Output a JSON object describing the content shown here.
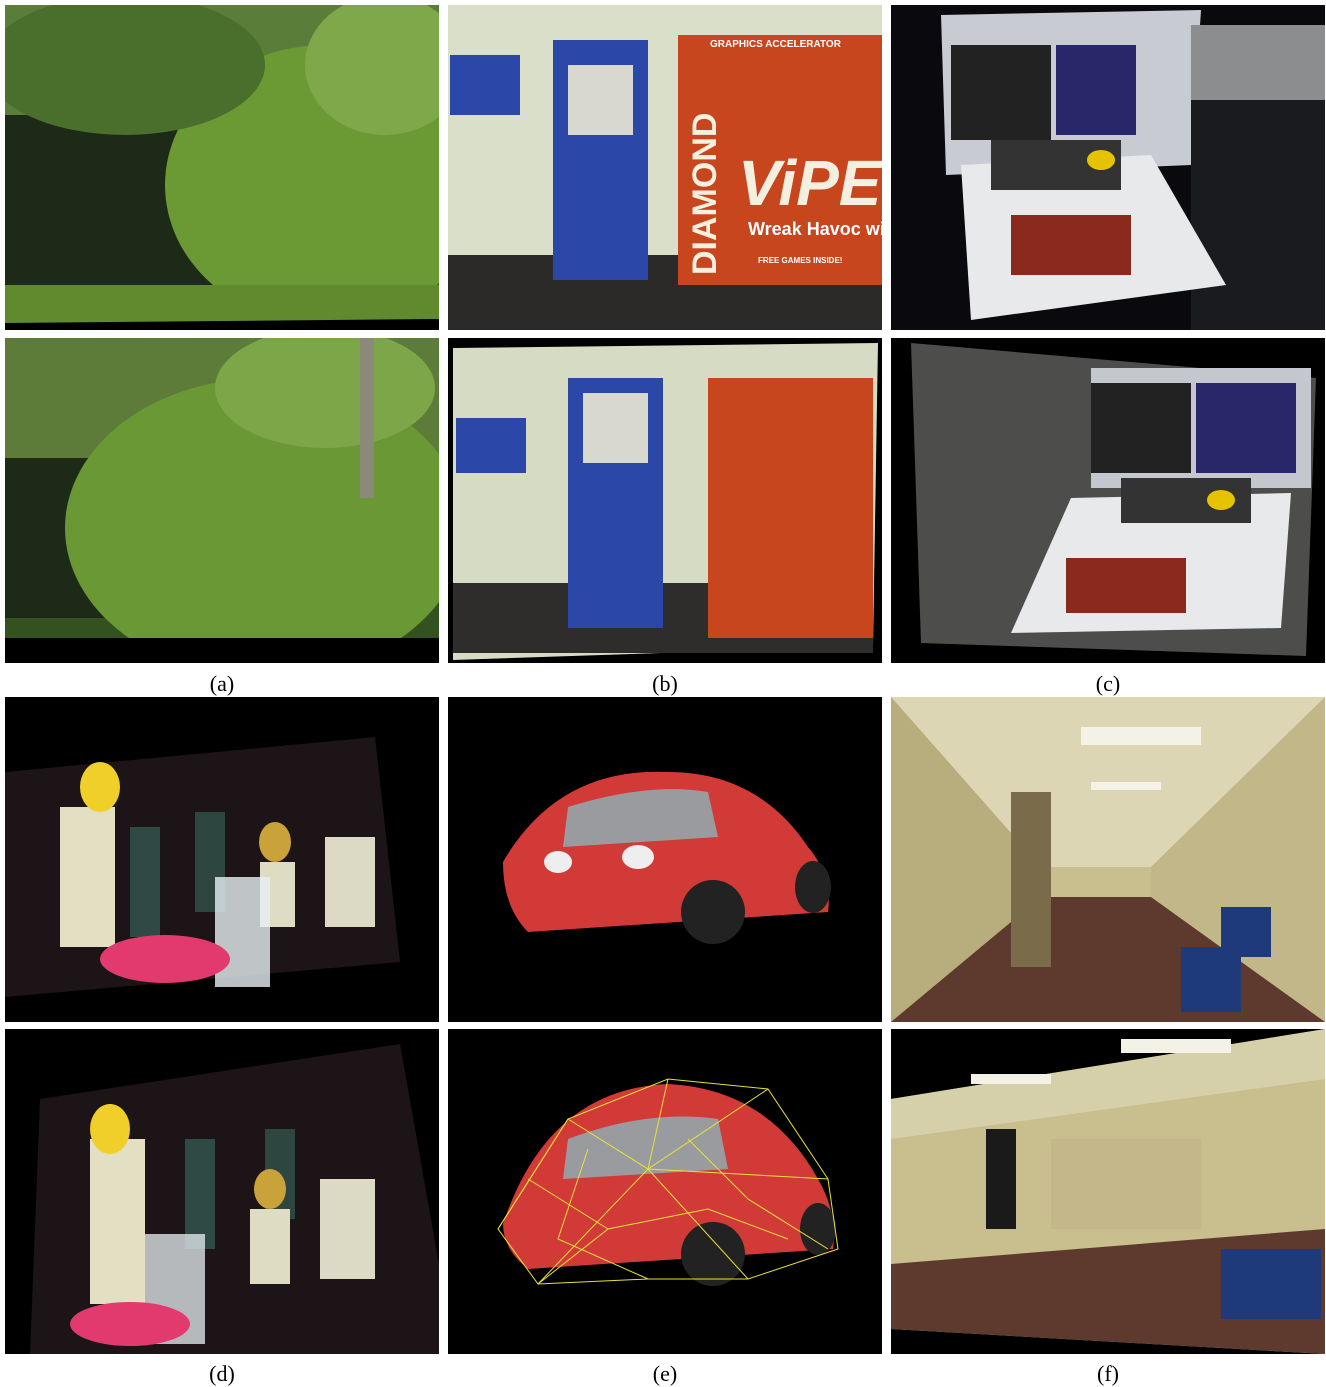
{
  "captions": {
    "a": "(a)",
    "b": "(b)",
    "c": "(c)",
    "d": "(d)",
    "e": "(e)",
    "f": "(f)"
  },
  "box_text": {
    "brand": "DIAMOND",
    "product": "ViPE",
    "tagline": "Wreak Havoc with",
    "header": "GRAPHICS ACCELERATOR",
    "free_games": "FREE GAMES INSIDE!"
  },
  "colors": {
    "background": "#ffffff",
    "panel_black": "#000000",
    "foliage": "#4f7a2a",
    "robot_blue": "#2b47a8",
    "box_red": "#c8461e",
    "car_red": "#d23a38",
    "wireframe": "#e8e23a",
    "hallway_beige": "#c9be8e"
  }
}
